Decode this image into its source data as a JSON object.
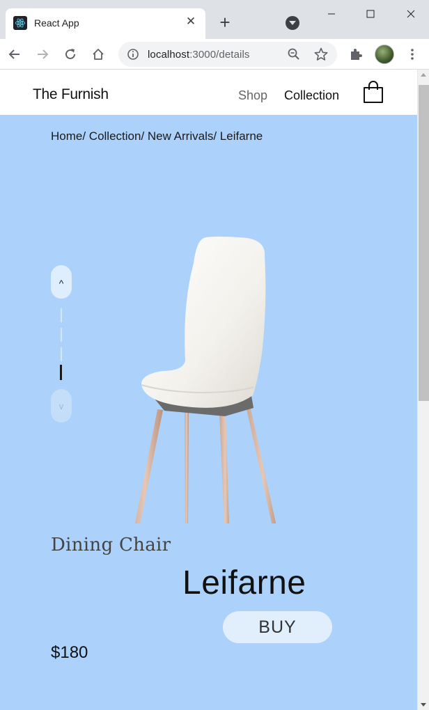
{
  "browser": {
    "tab_title": "React App",
    "tab_close": "✕",
    "new_tab": "+",
    "url_host": "localhost",
    "url_path": ":3000/details"
  },
  "site": {
    "brand": "The Furnish",
    "nav": {
      "shop": "Shop",
      "collection": "Collection"
    },
    "breadcrumb": "Home/ Collection/ New Arrivals/ Leifarne"
  },
  "carousel": {
    "up_glyph": "^",
    "down_glyph": "v",
    "slide_count": 4,
    "active_index": 3
  },
  "product": {
    "category": "Dining Chair",
    "name": "Leifarne",
    "buy_label": "BUY",
    "price": "$180"
  },
  "colors": {
    "page_background": "#acd2fc",
    "header_background": "#ffffff",
    "button_background": "#e1effd"
  },
  "icons": [
    "react-favicon",
    "close-icon",
    "plus-icon",
    "tab-search-icon",
    "minimize-icon",
    "maximize-icon",
    "close-window-icon",
    "back-icon",
    "forward-icon",
    "reload-icon",
    "home-icon",
    "info-icon",
    "zoom-out-icon",
    "star-icon",
    "extensions-icon",
    "menu-dots-icon",
    "shopping-bag-icon",
    "chevron-up-icon",
    "chevron-down-icon"
  ]
}
